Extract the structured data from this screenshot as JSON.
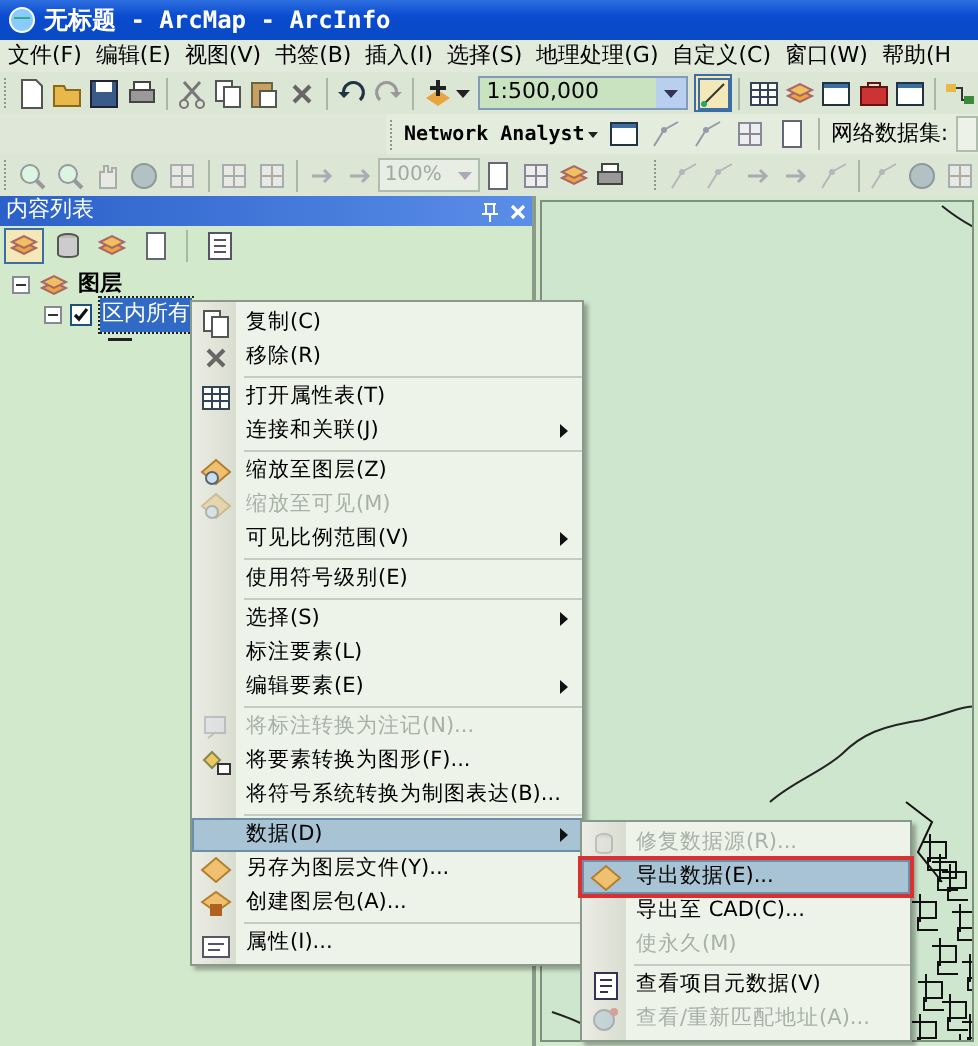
{
  "window": {
    "title": "无标题 - ArcMap - ArcInfo"
  },
  "menu_bar": [
    "文件(F)",
    "编辑(E)",
    "视图(V)",
    "书签(B)",
    "插入(I)",
    "选择(S)",
    "地理处理(G)",
    "自定义(C)",
    "窗口(W)",
    "帮助(H"
  ],
  "toolbar": {
    "scale": "1:500,000",
    "network_analyst": "Network Analyst",
    "network_dataset_label": "网络数据集:",
    "zoom_level": "100%"
  },
  "toc": {
    "title": "内容列表",
    "view_tabs": [
      {
        "selected": true
      },
      {
        "selected": false
      },
      {
        "selected": false
      },
      {
        "selected": false
      }
    ],
    "tree": [
      {
        "label": "图层",
        "expanded": true,
        "children": [
          {
            "label": "区内所有",
            "checked": true,
            "selected": true,
            "expanded": true
          }
        ]
      }
    ]
  },
  "context_menu": {
    "groups": [
      [
        {
          "label": "复制(C)",
          "disabled": false,
          "has_submenu": false,
          "selected": false
        },
        {
          "label": "移除(R)",
          "disabled": false,
          "has_submenu": false,
          "selected": false
        }
      ],
      [
        {
          "label": "打开属性表(T)",
          "disabled": false,
          "has_submenu": false,
          "selected": false
        },
        {
          "label": "连接和关联(J)",
          "disabled": false,
          "has_submenu": true,
          "selected": false
        }
      ],
      [
        {
          "label": "缩放至图层(Z)",
          "disabled": false,
          "has_submenu": false,
          "selected": false
        },
        {
          "label": "缩放至可见(M)",
          "disabled": true,
          "has_submenu": false,
          "selected": false
        },
        {
          "label": "可见比例范围(V)",
          "disabled": false,
          "has_submenu": true,
          "selected": false
        }
      ],
      [
        {
          "label": "使用符号级别(E)",
          "disabled": false,
          "has_submenu": false,
          "selected": false
        }
      ],
      [
        {
          "label": "选择(S)",
          "disabled": false,
          "has_submenu": true,
          "selected": false
        },
        {
          "label": "标注要素(L)",
          "disabled": false,
          "has_submenu": false,
          "selected": false
        },
        {
          "label": "编辑要素(E)",
          "disabled": false,
          "has_submenu": true,
          "selected": false
        }
      ],
      [
        {
          "label": "将标注转换为注记(N)...",
          "disabled": true,
          "has_submenu": false,
          "selected": false
        },
        {
          "label": "将要素转换为图形(F)...",
          "disabled": false,
          "has_submenu": false,
          "selected": false
        },
        {
          "label": "将符号系统转换为制图表达(B)...",
          "disabled": false,
          "has_submenu": false,
          "selected": false
        }
      ],
      [
        {
          "label": "数据(D)",
          "disabled": false,
          "has_submenu": true,
          "selected": true
        },
        {
          "label": "另存为图层文件(Y)...",
          "disabled": false,
          "has_submenu": false,
          "selected": false
        },
        {
          "label": "创建图层包(A)...",
          "disabled": false,
          "has_submenu": false,
          "selected": false
        }
      ],
      [
        {
          "label": "属性(I)...",
          "disabled": false,
          "has_submenu": false,
          "selected": false
        }
      ]
    ]
  },
  "data_submenu": {
    "groups": [
      [
        {
          "label": "修复数据源(R)...",
          "disabled": true,
          "selected": false
        },
        {
          "label": "导出数据(E)...",
          "disabled": false,
          "selected": true
        },
        {
          "label": "导出至 CAD(C)...",
          "disabled": false,
          "selected": false
        },
        {
          "label": "使永久(M)",
          "disabled": true,
          "selected": false
        }
      ],
      [
        {
          "label": "查看项目元数据(V)",
          "disabled": false,
          "selected": false
        },
        {
          "label": "查看/重新匹配地址(A)...",
          "disabled": true,
          "selected": false
        }
      ]
    ]
  }
}
